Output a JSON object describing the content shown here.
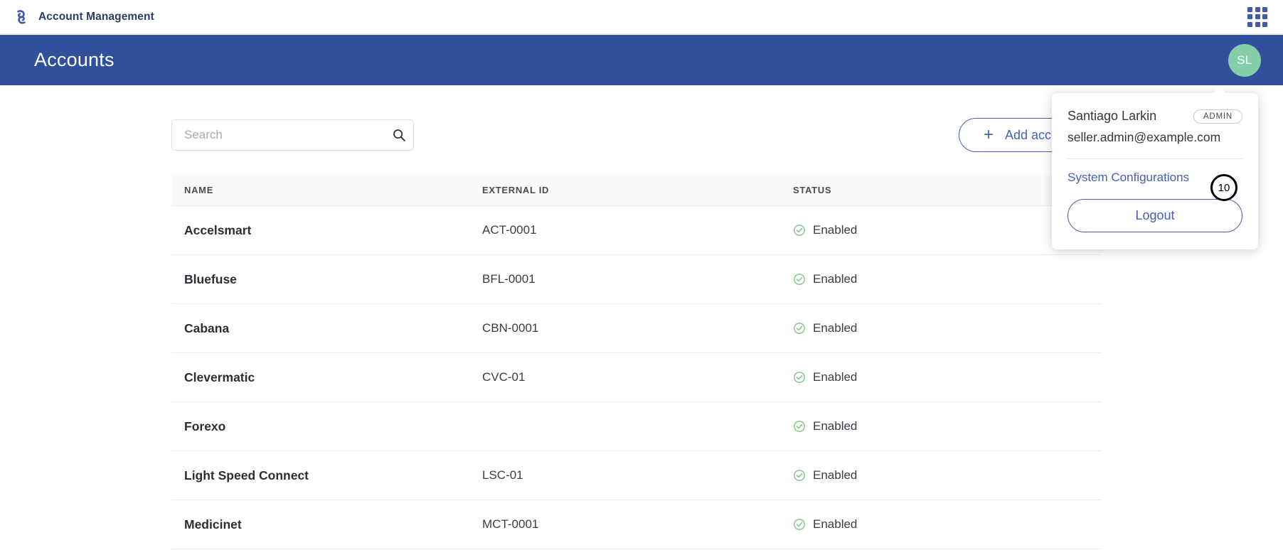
{
  "appbar": {
    "brand_title": "Account Management",
    "logo_icon": "swirl-logo-icon",
    "apps_icon": "apps-grid-icon"
  },
  "banner": {
    "title": "Accounts",
    "avatar_initials": "SL"
  },
  "toolbar": {
    "search_placeholder": "Search",
    "search_value": "",
    "search_icon": "search-icon",
    "add_account_label": "Add account",
    "add_plus": "+"
  },
  "table": {
    "columns": [
      "NAME",
      "EXTERNAL ID",
      "STATUS"
    ],
    "rows": [
      {
        "name": "Accelsmart",
        "external_id": "ACT-0001",
        "status": "Enabled"
      },
      {
        "name": "Bluefuse",
        "external_id": "BFL-0001",
        "status": "Enabled"
      },
      {
        "name": "Cabana",
        "external_id": "CBN-0001",
        "status": "Enabled"
      },
      {
        "name": "Clevermatic",
        "external_id": "CVC-01",
        "status": "Enabled"
      },
      {
        "name": "Forexo",
        "external_id": "",
        "status": "Enabled"
      },
      {
        "name": "Light Speed Connect",
        "external_id": "LSC-01",
        "status": "Enabled"
      },
      {
        "name": "Medicinet",
        "external_id": "MCT-0001",
        "status": "Enabled"
      }
    ]
  },
  "profile_menu": {
    "user_name": "Santiago Larkin",
    "role_badge": "ADMIN",
    "email": "seller.admin@example.com",
    "system_configurations_label": "System Configurations",
    "logout_label": "Logout"
  },
  "annotation": {
    "marker_number": "10"
  },
  "colors": {
    "banner_blue": "#30509b",
    "accent_blue": "#4560b4",
    "avatar_green": "#86cdaa",
    "status_green": "#7cc47f",
    "brand_navy": "#2f3b66"
  }
}
